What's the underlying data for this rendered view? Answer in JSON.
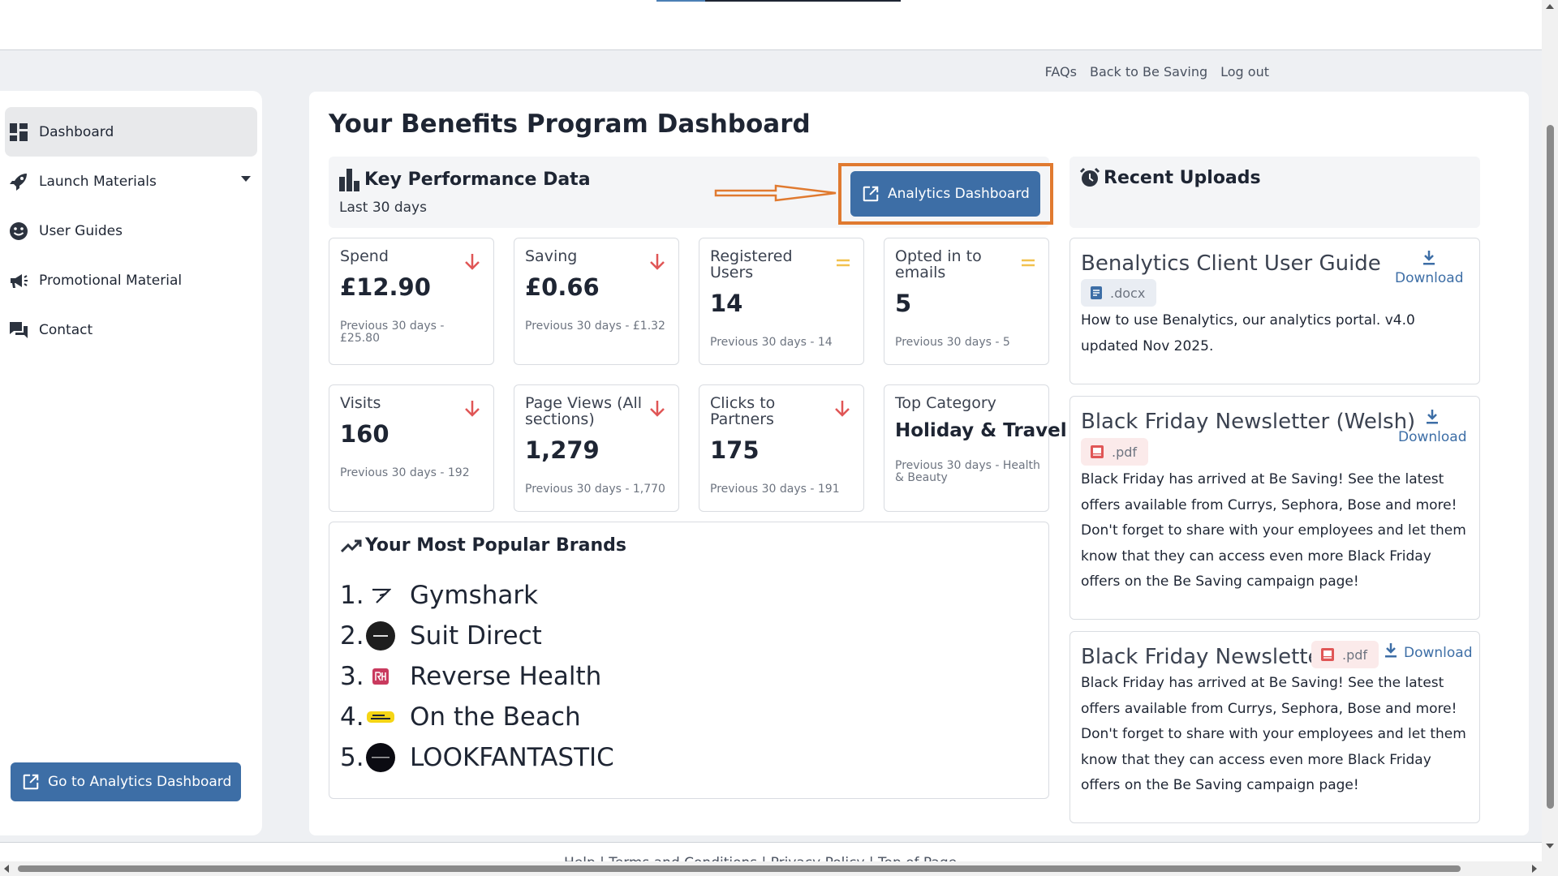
{
  "header": {
    "links": [
      "FAQs",
      "Back to Be Saving",
      "Log out"
    ]
  },
  "sidebar": {
    "items": [
      {
        "label": "Dashboard",
        "icon": "dashboard-icon",
        "active": true
      },
      {
        "label": "Launch Materials",
        "icon": "rocket-icon",
        "has_dropdown": true
      },
      {
        "label": "User Guides",
        "icon": "smiley-icon"
      },
      {
        "label": "Promotional Material",
        "icon": "megaphone-icon"
      },
      {
        "label": "Contact",
        "icon": "chat-icon"
      }
    ],
    "go_button": "Go to Analytics Dashboard"
  },
  "main": {
    "title": "Your Benefits Program Dashboard",
    "kpi": {
      "title": "Key Performance Data",
      "subtitle": "Last 30 days",
      "analytics_button": "Analytics Dashboard",
      "cards": [
        {
          "label": "Spend",
          "value": "£12.90",
          "prev": "Previous 30 days - £25.80",
          "trend": "down"
        },
        {
          "label": "Saving",
          "value": "£0.66",
          "prev": "Previous 30 days - £1.32",
          "trend": "down"
        },
        {
          "label": "Registered Users",
          "value": "14",
          "prev": "Previous 30 days - 14",
          "trend": "equal"
        },
        {
          "label": "Opted in to emails",
          "value": "5",
          "prev": "Previous 30 days - 5",
          "trend": "equal"
        },
        {
          "label": "Visits",
          "value": "160",
          "prev": "Previous 30 days - 192",
          "trend": "down"
        },
        {
          "label": "Page Views (All sections)",
          "value": "1,279",
          "prev": "Previous 30 days - 1,770",
          "trend": "down"
        },
        {
          "label": "Clicks to Partners",
          "value": "175",
          "prev": "Previous 30 days - 191",
          "trend": "down"
        },
        {
          "label": "Top Category",
          "value": "Holiday & Travel",
          "prev": "Previous 30 days - Health & Beauty",
          "trend": "none"
        }
      ]
    },
    "brands": {
      "title": "Your Most Popular Brands",
      "items": [
        {
          "rank": "1.",
          "name": "Gymshark"
        },
        {
          "rank": "2.",
          "name": "Suit Direct"
        },
        {
          "rank": "3.",
          "name": "Reverse Health"
        },
        {
          "rank": "4.",
          "name": "On the Beach"
        },
        {
          "rank": "5.",
          "name": "LOOKFANTASTIC"
        }
      ]
    },
    "uploads": {
      "title": "Recent Uploads",
      "download_label": "Download",
      "items": [
        {
          "title": "Benalytics Client User Guide",
          "ext": ".docx",
          "desc": "How to use Benalytics, our analytics portal. v4.0 updated Nov 2025."
        },
        {
          "title": "Black Friday Newsletter (Welsh)",
          "ext": ".pdf",
          "desc": "Black Friday has arrived at Be Saving! See the latest offers available from Currys, Sephora, Bose and more! Don't forget to share with your employees and let them know that they can access even more Black Friday offers on the Be Saving campaign page!"
        },
        {
          "title": "Black Friday Newsletter",
          "ext": ".pdf",
          "desc": "Black Friday has arrived at Be Saving! See the latest offers available from Currys, Sephora, Bose and more! Don't forget to share with your employees and let them know that they can access even more Black Friday offers on the Be Saving campaign page!"
        }
      ]
    }
  },
  "footer": {
    "links": "Help  |  Terms and Conditions  |  Privacy Policy  |  Top of Page"
  },
  "colors": {
    "primary": "#3d6ea6",
    "highlight": "#e07a30",
    "trend_down": "#e05656",
    "trend_equal": "#f2c14e"
  }
}
